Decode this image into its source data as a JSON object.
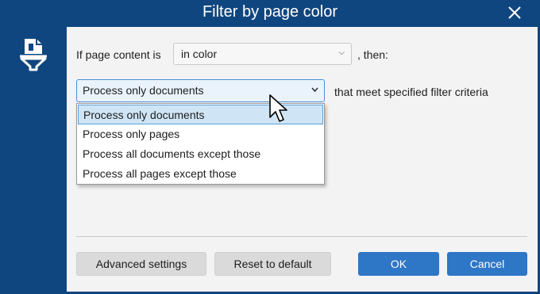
{
  "window": {
    "title": "Filter by page color"
  },
  "colors": {
    "frame": "#10467f",
    "accent": "#2e76c6",
    "panel": "#f3f3f3"
  },
  "icons": {
    "sidebar": "page-filter-icon",
    "close": "close-icon",
    "chevron": "chevron-down-icon",
    "pointer": "mouse-pointer-icon"
  },
  "condition": {
    "prefix": "If page content is",
    "selected": "in color",
    "suffix": ", then:"
  },
  "mode": {
    "selected": "Process only documents",
    "suffix": "that meet specified filter criteria",
    "options": [
      "Process only documents",
      "Process only pages",
      "Process all documents except those",
      "Process all pages except those"
    ]
  },
  "buttons": {
    "advanced": "Advanced settings",
    "reset": "Reset to default",
    "ok": "OK",
    "cancel": "Cancel"
  }
}
